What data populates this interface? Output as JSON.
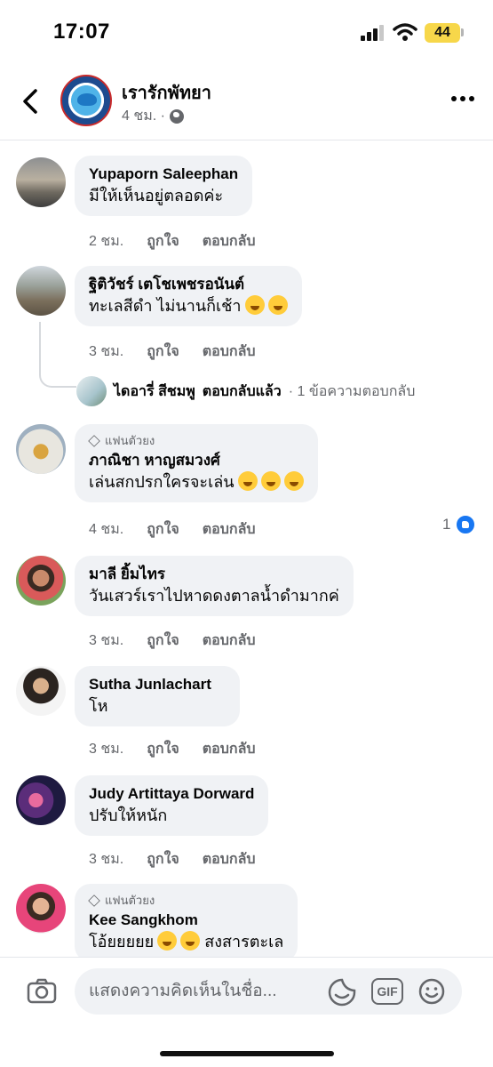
{
  "status_bar": {
    "time": "17:07",
    "battery": "44"
  },
  "header": {
    "page_name": "เรารักพัทยา",
    "time_ago": "4 ชม. ·"
  },
  "comments": [
    {
      "name": "Yupaporn Saleephan",
      "text": "มีให้เห็นอยู่ตลอดค่ะ",
      "time": "2 ชม.",
      "like": "ถูกใจ",
      "reply": "ตอบกลับ"
    },
    {
      "name": "ฐิติวัชร์ เตโชเพชรอนันต์",
      "text": "ทะเลสีดำ ไม่นานก็เช้า",
      "time": "3 ชม.",
      "like": "ถูกใจ",
      "reply": "ตอบกลับ",
      "emojis": [
        "grin",
        "grin"
      ]
    },
    {
      "badge": "แฟนตัวยง",
      "name": "ภาณิชา หาญสมวงศ์",
      "text": "เล่นสกปรกใครจะเล่น",
      "time": "4 ชม.",
      "like": "ถูกใจ",
      "reply": "ตอบกลับ",
      "emojis": [
        "shush",
        "shush",
        "shush"
      ],
      "reaction_count": "1"
    },
    {
      "name": "มาลี ยิ้มไทร",
      "text": "วันเสวร์เราไปหาดดงตาลน้ำดำมากค่",
      "time": "3 ชม.",
      "like": "ถูกใจ",
      "reply": "ตอบกลับ"
    },
    {
      "name": "Sutha Junlachart",
      "text": "โห",
      "time": "3 ชม.",
      "like": "ถูกใจ",
      "reply": "ตอบกลับ"
    },
    {
      "name": "Judy Artittaya Dorward",
      "text": "ปรับให้หนัก",
      "time": "3 ชม.",
      "like": "ถูกใจ",
      "reply": "ตอบกลับ"
    },
    {
      "badge": "แฟนตัวยง",
      "name": "Kee Sangkhom",
      "text_before": "โอ้ยยยยย",
      "text_after": "สงสารตะเล",
      "emojis": [
        "sad",
        "cry"
      ]
    }
  ],
  "reply_summary": {
    "name": "ไดอารี่ สีชมพู",
    "action": "ตอบกลับแล้ว",
    "meta": "· 1 ข้อความตอบกลับ"
  },
  "composer": {
    "placeholder": "แสดงความคิดเห็นในชื่อ...",
    "gif_label": "GIF"
  },
  "icons": [
    "back-arrow-icon",
    "globe-icon",
    "more-icon",
    "diamond-icon",
    "like-icon",
    "camera-icon",
    "sticker-icon",
    "gif-icon",
    "smiley-icon"
  ],
  "colors": {
    "bubble": "#f0f2f5",
    "secondary_text": "#65676b",
    "like_blue": "#1877f2",
    "battery": "#f7d74a"
  }
}
